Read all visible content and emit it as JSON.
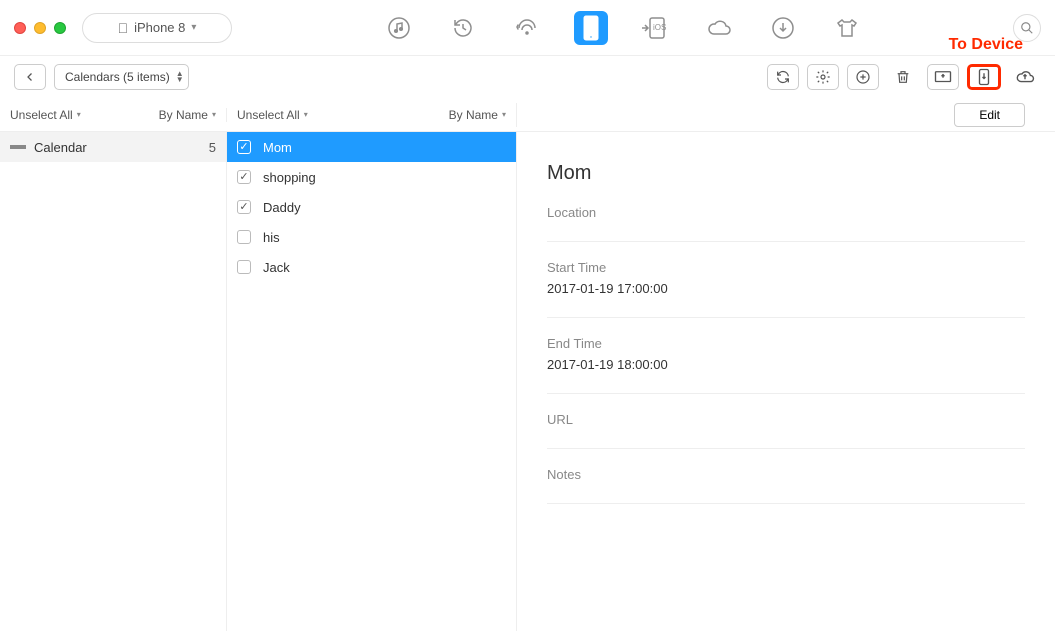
{
  "device": {
    "name": "iPhone 8"
  },
  "annotation": "To Device",
  "breadcrumb": {
    "label": "Calendars (5 items)"
  },
  "headers": {
    "unselect": "Unselect All",
    "byname": "By Name",
    "edit": "Edit"
  },
  "sidebar": {
    "items": [
      {
        "label": "Calendar",
        "count": "5"
      }
    ]
  },
  "events": [
    {
      "label": "Mom",
      "checked": true,
      "selected": true
    },
    {
      "label": "shopping",
      "checked": true,
      "selected": false
    },
    {
      "label": "Daddy",
      "checked": true,
      "selected": false
    },
    {
      "label": "his",
      "checked": false,
      "selected": false
    },
    {
      "label": "Jack",
      "checked": false,
      "selected": false
    }
  ],
  "detail": {
    "title": "Mom",
    "location_label": "Location",
    "location_value": "",
    "start_label": "Start Time",
    "start_value": "2017-01-19 17:00:00",
    "end_label": "End Time",
    "end_value": "2017-01-19 18:00:00",
    "url_label": "URL",
    "url_value": "",
    "notes_label": "Notes",
    "notes_value": ""
  }
}
